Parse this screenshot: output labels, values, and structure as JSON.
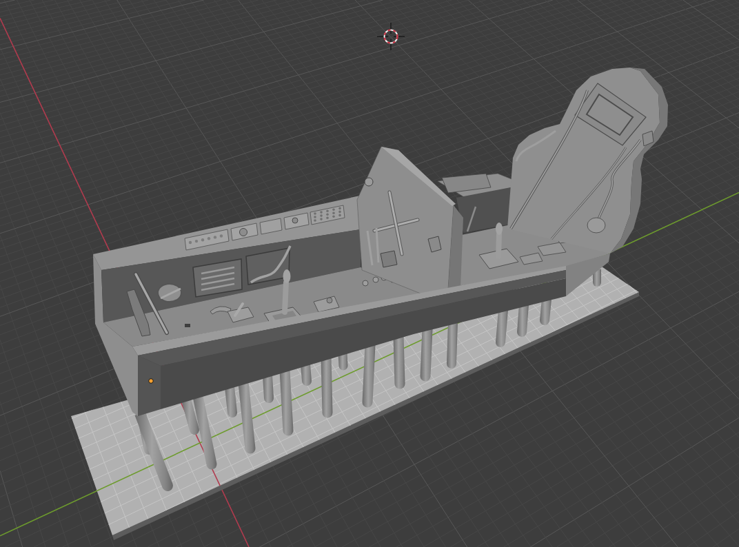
{
  "viewport": {
    "overlays": {
      "floor": true,
      "axis_x": true,
      "axis_y": true,
      "cursor_3d": true,
      "origins": true
    }
  }
}
